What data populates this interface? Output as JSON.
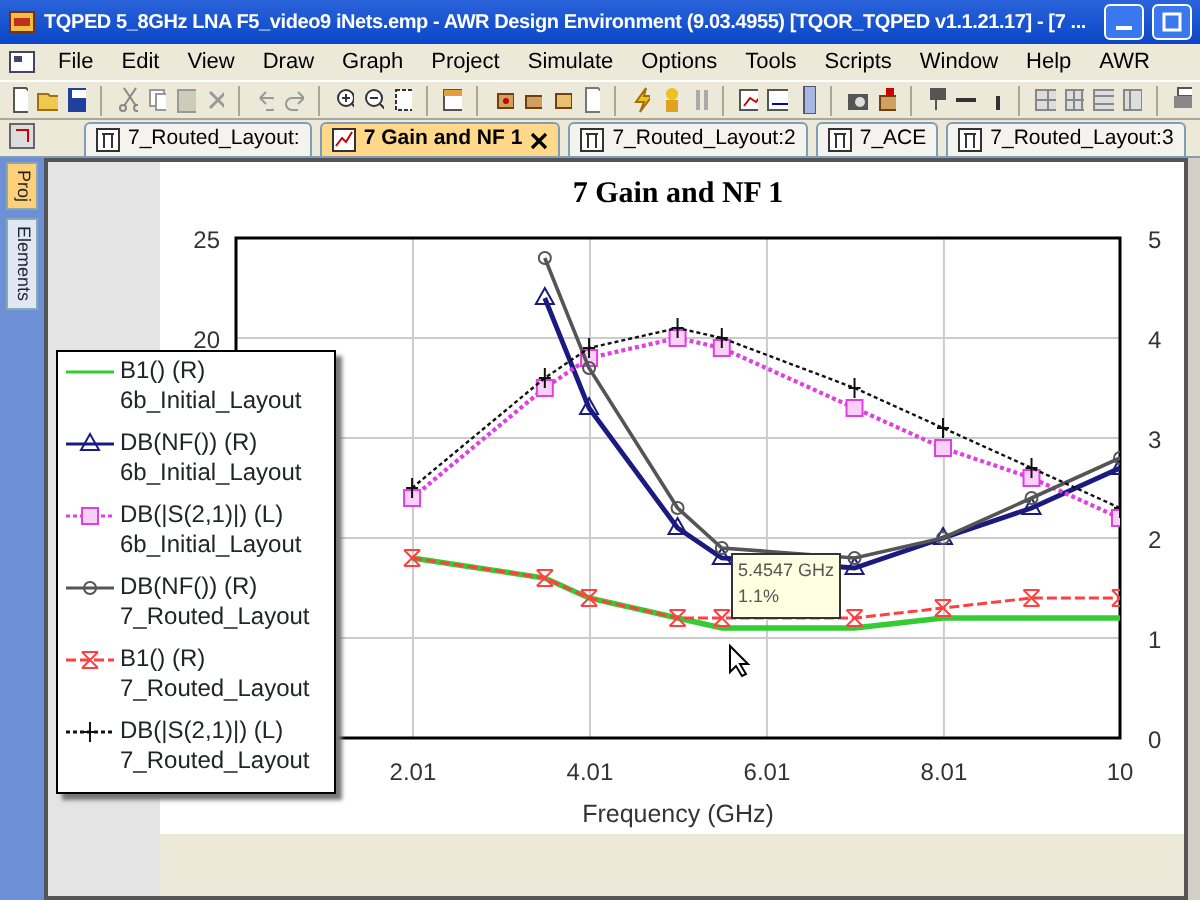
{
  "window": {
    "title": "TQPED 5_8GHz LNA F5_video9 iNets.emp - AWR Design Environment (9.03.4955) [TQOR_TQPED v1.1.21.17] - [7 ..."
  },
  "menu": [
    "File",
    "Edit",
    "View",
    "Draw",
    "Graph",
    "Project",
    "Simulate",
    "Options",
    "Tools",
    "Scripts",
    "Window",
    "Help",
    "AWR"
  ],
  "tabs": [
    {
      "label": "7_Routed_Layout:",
      "selected": false,
      "closable": false
    },
    {
      "label": "7 Gain and NF 1",
      "selected": true,
      "closable": true
    },
    {
      "label": "7_Routed_Layout:2",
      "selected": false,
      "closable": false
    },
    {
      "label": "7_ACE",
      "selected": false,
      "closable": false
    },
    {
      "label": "7_Routed_Layout:3",
      "selected": false,
      "closable": false
    }
  ],
  "side_tabs": [
    {
      "label": "Proj",
      "selected": true
    },
    {
      "label": "Elements",
      "selected": false
    }
  ],
  "graph": {
    "chart_data": {
      "type": "line",
      "title": "7 Gain and NF 1",
      "xlabel": "Frequency (GHz)",
      "xlim": [
        0.01,
        10
      ],
      "xticks": [
        {
          "value": 2.01,
          "label": "2.01"
        },
        {
          "value": 4.01,
          "label": "4.01"
        },
        {
          "value": 6.01,
          "label": "6.01"
        },
        {
          "value": 8.01,
          "label": "8.01"
        },
        {
          "value": 10,
          "label": "10"
        }
      ],
      "ylim": [
        0,
        25
      ],
      "yticks": [
        20,
        25
      ],
      "y2lim": [
        0,
        5
      ],
      "y2ticks": [
        0,
        1,
        2,
        3,
        4,
        5
      ],
      "grid": true,
      "x": [
        2,
        3.5,
        4,
        5,
        5.5,
        7,
        8,
        9,
        10
      ],
      "series": [
        {
          "name": "B1() (R)",
          "color": "#33cc33",
          "axis": "y2",
          "marker": "none",
          "line_style": "solid",
          "values": [
            1.8,
            1.6,
            1.4,
            1.2,
            1.1,
            1.1,
            1.2,
            1.2,
            1.2
          ]
        },
        {
          "name": "DB(NF()) (R)",
          "color": "#1a1a80",
          "axis": "y2",
          "marker": "triangle",
          "line_style": "solid",
          "values": [
            null,
            4.4,
            3.3,
            2.1,
            1.8,
            1.7,
            2,
            2.3,
            2.7
          ]
        },
        {
          "name": "DB(|S(2,1)|) (L)",
          "color": "#e040e0",
          "marker": "square",
          "line_style": "dotted",
          "values": [
            12,
            17.5,
            19,
            20,
            19.5,
            16.5,
            14.5,
            13,
            11
          ]
        },
        {
          "name": "DB(NF()) (R)",
          "color": "#555555",
          "axis": "y2",
          "marker": "circle",
          "line_style": "solid",
          "values": [
            null,
            4.8,
            3.7,
            2.3,
            1.9,
            1.8,
            2,
            2.4,
            2.8
          ]
        },
        {
          "name": "B1() (R)",
          "color": "#ff4040",
          "axis": "y2",
          "marker": "x",
          "line_style": "dashed",
          "values": [
            1.8,
            1.6,
            1.4,
            1.2,
            1.2,
            1.2,
            1.3,
            1.4,
            1.4
          ]
        },
        {
          "name": "DB(|S(2,1)|) (L)",
          "color": "#111111",
          "marker": "cross",
          "line_style": "dotted",
          "values": [
            12.5,
            18,
            19.5,
            20.5,
            20,
            17.5,
            15.5,
            13.5,
            11.5
          ]
        }
      ],
      "annotations": [
        "5.4547 GHz",
        "1.1%"
      ]
    },
    "legend": [
      {
        "source": "6b_Initial_Layout"
      },
      {
        "source": "6b_Initial_Layout"
      },
      {
        "source": "6b_Initial_Layout"
      },
      {
        "source": "7_Routed_Layout"
      },
      {
        "source": "7_Routed_Layout"
      },
      {
        "source": "7_Routed_Layout"
      }
    ]
  }
}
